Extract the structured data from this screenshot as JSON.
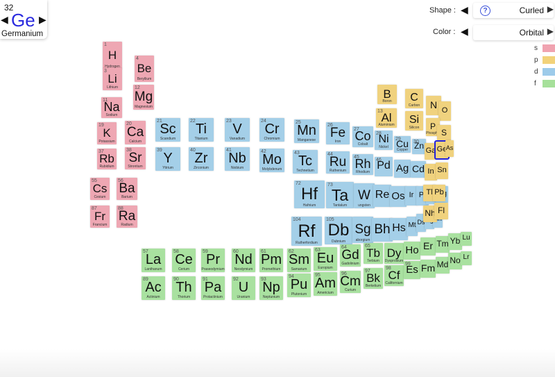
{
  "selected_element": {
    "number": "32",
    "symbol": "Ge",
    "name": "Germanium",
    "prev_arrow": "◀",
    "next_arrow": "▶"
  },
  "controls": {
    "shape": {
      "label": "Shape :",
      "value": "Curled"
    },
    "color": {
      "label": "Color :",
      "value": "Orbital"
    },
    "left_arrow": "◀",
    "right_arrow": "▶",
    "help_glyph": "?"
  },
  "legend": [
    {
      "label": "s",
      "color": "#f0a3b0"
    },
    {
      "label": "p",
      "color": "#f2d27a"
    },
    {
      "label": "d",
      "color": "#9dcbea"
    },
    {
      "label": "f",
      "color": "#a6e09a"
    }
  ],
  "block_colors": {
    "s": "#eea7b3",
    "p": "#f0d27e",
    "d": "#a4cfe8",
    "f": "#a9e1a0"
  },
  "elements": [
    {
      "num": "1",
      "sym": "H",
      "name": "Hydrogen",
      "block": "s"
    },
    {
      "num": "4",
      "sym": "Be",
      "name": "Beryllium",
      "block": "s"
    },
    {
      "num": "3",
      "sym": "Li",
      "name": "Lithium",
      "block": "s"
    },
    {
      "num": "12",
      "sym": "Mg",
      "name": "Magnesium",
      "block": "s"
    },
    {
      "num": "11",
      "sym": "Na",
      "name": "Sodium",
      "block": "s"
    },
    {
      "num": "19",
      "sym": "K",
      "name": "Potassium",
      "block": "s"
    },
    {
      "num": "20",
      "sym": "Ca",
      "name": "Calcium",
      "block": "s"
    },
    {
      "num": "37",
      "sym": "Rb",
      "name": "Rubidium",
      "block": "s"
    },
    {
      "num": "38",
      "sym": "Sr",
      "name": "Strontium",
      "block": "s"
    },
    {
      "num": "55",
      "sym": "Cs",
      "name": "Cesium",
      "block": "s"
    },
    {
      "num": "56",
      "sym": "Ba",
      "name": "Barium",
      "block": "s"
    },
    {
      "num": "87",
      "sym": "Fr",
      "name": "Francium",
      "block": "s"
    },
    {
      "num": "88",
      "sym": "Ra",
      "name": "Radium",
      "block": "s"
    },
    {
      "num": "21",
      "sym": "Sc",
      "name": "Scandium",
      "block": "d"
    },
    {
      "num": "22",
      "sym": "Ti",
      "name": "Titanium",
      "block": "d"
    },
    {
      "num": "23",
      "sym": "V",
      "name": "Vanadium",
      "block": "d"
    },
    {
      "num": "24",
      "sym": "Cr",
      "name": "Chromium",
      "block": "d"
    },
    {
      "num": "25",
      "sym": "Mn",
      "name": "Manganese",
      "block": "d"
    },
    {
      "num": "26",
      "sym": "Fe",
      "name": "Iron",
      "block": "d"
    },
    {
      "num": "27",
      "sym": "Co",
      "name": "Cobalt",
      "block": "d"
    },
    {
      "num": "28",
      "sym": "Ni",
      "name": "Nickel",
      "block": "d"
    },
    {
      "num": "29",
      "sym": "Cu",
      "name": "Copper",
      "block": "d"
    },
    {
      "num": "30",
      "sym": "Zn",
      "name": "",
      "block": "d"
    },
    {
      "num": "39",
      "sym": "Y",
      "name": "Yttrium",
      "block": "d"
    },
    {
      "num": "40",
      "sym": "Zr",
      "name": "Zirconium",
      "block": "d"
    },
    {
      "num": "41",
      "sym": "Nb",
      "name": "Niobium",
      "block": "d"
    },
    {
      "num": "42",
      "sym": "Mo",
      "name": "Molybdenum",
      "block": "d"
    },
    {
      "num": "43",
      "sym": "Tc",
      "name": "Technetium",
      "block": "d"
    },
    {
      "num": "44",
      "sym": "Ru",
      "name": "Ruthenium",
      "block": "d"
    },
    {
      "num": "45",
      "sym": "Rh",
      "name": "Rhodium",
      "block": "d"
    },
    {
      "num": "46",
      "sym": "Pd",
      "name": "",
      "block": "d"
    },
    {
      "num": "",
      "sym": "Ag",
      "name": "",
      "block": "d"
    },
    {
      "num": "",
      "sym": "Cd",
      "name": "",
      "block": "d"
    },
    {
      "num": "72",
      "sym": "Hf",
      "name": "Hafnium",
      "block": "d"
    },
    {
      "num": "73",
      "sym": "Ta",
      "name": "Tantalum",
      "block": "d"
    },
    {
      "num": "",
      "sym": "W",
      "name": "ungsten",
      "block": "d"
    },
    {
      "num": "",
      "sym": "Re",
      "name": "",
      "block": "d"
    },
    {
      "num": "",
      "sym": "Os",
      "name": "",
      "block": "d"
    },
    {
      "num": "",
      "sym": "Ir",
      "name": "",
      "block": "d"
    },
    {
      "num": "",
      "sym": "Pt",
      "name": "",
      "block": "d"
    },
    {
      "num": "",
      "sym": "Au",
      "name": "",
      "block": "d"
    },
    {
      "num": "",
      "sym": "Hg",
      "name": "",
      "block": "d"
    },
    {
      "num": "104",
      "sym": "Rf",
      "name": "Rutherfordium",
      "block": "d"
    },
    {
      "num": "105",
      "sym": "Db",
      "name": "Dubnium",
      "block": "d"
    },
    {
      "num": "",
      "sym": "Sg",
      "name": "aborgium",
      "block": "d"
    },
    {
      "num": "",
      "sym": "Bh",
      "name": "",
      "block": "d"
    },
    {
      "num": "",
      "sym": "Hs",
      "name": "",
      "block": "d"
    },
    {
      "num": "",
      "sym": "Mt",
      "name": "",
      "block": "d"
    },
    {
      "num": "",
      "sym": "Ds",
      "name": "",
      "block": "d"
    },
    {
      "num": "",
      "sym": "Rg",
      "name": "",
      "block": "d"
    },
    {
      "num": "",
      "sym": "Cn",
      "name": "",
      "block": "d"
    },
    {
      "num": "",
      "sym": "B",
      "name": "Boron",
      "block": "p"
    },
    {
      "num": "",
      "sym": "C",
      "name": "Carbon",
      "block": "p"
    },
    {
      "num": "",
      "sym": "N",
      "name": "",
      "block": "p"
    },
    {
      "num": "",
      "sym": "O",
      "name": "",
      "block": "p"
    },
    {
      "num": "13",
      "sym": "Al",
      "name": "Aluminium",
      "block": "p"
    },
    {
      "num": "",
      "sym": "Si",
      "name": "Silicon",
      "block": "p"
    },
    {
      "num": "",
      "sym": "P",
      "name": "Phosphorus",
      "block": "p"
    },
    {
      "num": "",
      "sym": "S",
      "name": "",
      "block": "p"
    },
    {
      "num": "",
      "sym": "Ga",
      "name": "",
      "block": "p"
    },
    {
      "num": "",
      "sym": "Ge",
      "name": "",
      "block": "p"
    },
    {
      "num": "",
      "sym": "As",
      "name": "",
      "block": "p"
    },
    {
      "num": "",
      "sym": "In",
      "name": "",
      "block": "p"
    },
    {
      "num": "",
      "sym": "Sn",
      "name": "",
      "block": "p"
    },
    {
      "num": "",
      "sym": "Tl",
      "name": "",
      "block": "p"
    },
    {
      "num": "",
      "sym": "Pb",
      "name": "",
      "block": "p"
    },
    {
      "num": "",
      "sym": "Nh",
      "name": "",
      "block": "p"
    },
    {
      "num": "",
      "sym": "Fl",
      "name": "",
      "block": "p"
    },
    {
      "num": "57",
      "sym": "La",
      "name": "Lanthanum",
      "block": "f"
    },
    {
      "num": "58",
      "sym": "Ce",
      "name": "Cerium",
      "block": "f"
    },
    {
      "num": "59",
      "sym": "Pr",
      "name": "Praseodymium",
      "block": "f"
    },
    {
      "num": "60",
      "sym": "Nd",
      "name": "Neodymium",
      "block": "f"
    },
    {
      "num": "61",
      "sym": "Pm",
      "name": "Promethium",
      "block": "f"
    },
    {
      "num": "62",
      "sym": "Sm",
      "name": "Samarium",
      "block": "f"
    },
    {
      "num": "63",
      "sym": "Eu",
      "name": "Europium",
      "block": "f"
    },
    {
      "num": "64",
      "sym": "Gd",
      "name": "Gadolinium",
      "block": "f"
    },
    {
      "num": "65",
      "sym": "Tb",
      "name": "Terbium",
      "block": "f"
    },
    {
      "num": "",
      "sym": "Dy",
      "name": "Dysprosium",
      "block": "f"
    },
    {
      "num": "",
      "sym": "Ho",
      "name": "",
      "block": "f"
    },
    {
      "num": "",
      "sym": "Er",
      "name": "",
      "block": "f"
    },
    {
      "num": "",
      "sym": "Tm",
      "name": "",
      "block": "f"
    },
    {
      "num": "",
      "sym": "Yb",
      "name": "",
      "block": "f"
    },
    {
      "num": "",
      "sym": "Lu",
      "name": "",
      "block": "f"
    },
    {
      "num": "89",
      "sym": "Ac",
      "name": "Actinium",
      "block": "f"
    },
    {
      "num": "90",
      "sym": "Th",
      "name": "Thorium",
      "block": "f"
    },
    {
      "num": "91",
      "sym": "Pa",
      "name": "Protactinium",
      "block": "f"
    },
    {
      "num": "92",
      "sym": "U",
      "name": "Uranium",
      "block": "f"
    },
    {
      "num": "93",
      "sym": "Np",
      "name": "Neptunium",
      "block": "f"
    },
    {
      "num": "94",
      "sym": "Pu",
      "name": "Plutonium",
      "block": "f"
    },
    {
      "num": "95",
      "sym": "Am",
      "name": "Americium",
      "block": "f"
    },
    {
      "num": "96",
      "sym": "Cm",
      "name": "Curium",
      "block": "f"
    },
    {
      "num": "97",
      "sym": "Bk",
      "name": "Berkelium",
      "block": "f"
    },
    {
      "num": "98",
      "sym": "Cf",
      "name": "Californium",
      "block": "f"
    },
    {
      "num": "99",
      "sym": "Es",
      "name": "",
      "block": "f"
    },
    {
      "num": "",
      "sym": "Fm",
      "name": "",
      "block": "f"
    },
    {
      "num": "",
      "sym": "Md",
      "name": "",
      "block": "f"
    },
    {
      "num": "",
      "sym": "No",
      "name": "",
      "block": "f"
    },
    {
      "num": "",
      "sym": "Lr",
      "name": "",
      "block": "f"
    }
  ]
}
